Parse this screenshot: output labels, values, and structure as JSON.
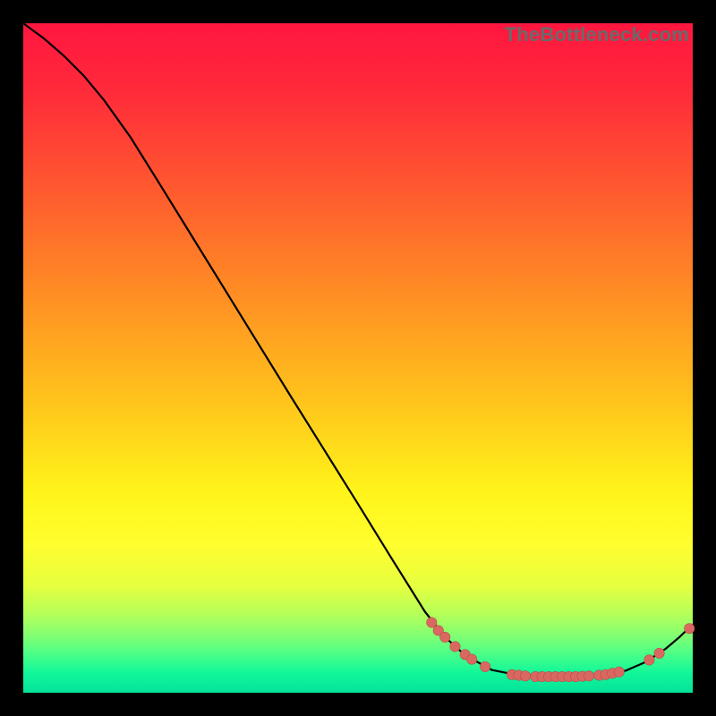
{
  "watermark": "TheBottleneck.com",
  "colors": {
    "background": "#000000",
    "curve_stroke": "#000000",
    "marker_fill": "#d96861",
    "marker_stroke": "#b84d48"
  },
  "chart_data": {
    "type": "line",
    "title": "",
    "xlabel": "",
    "ylabel": "",
    "xlim": [
      0,
      100
    ],
    "ylim": [
      0,
      100
    ],
    "curve": {
      "x": [
        0,
        3,
        6,
        9,
        12,
        16,
        20,
        25,
        30,
        35,
        40,
        45,
        50,
        55,
        60,
        63,
        66,
        70,
        74,
        78,
        82,
        86,
        90,
        93,
        96,
        98,
        100
      ],
      "y": [
        100,
        97.8,
        95.2,
        92.2,
        88.6,
        83.0,
        76.6,
        68.5,
        60.4,
        52.3,
        44.2,
        36.2,
        28.2,
        20.1,
        12.1,
        8.3,
        5.6,
        3.4,
        2.6,
        2.4,
        2.4,
        2.6,
        3.3,
        4.6,
        6.6,
        8.3,
        10.2
      ]
    },
    "markers": [
      {
        "x": 61.0,
        "y": 10.5
      },
      {
        "x": 62.0,
        "y": 9.3
      },
      {
        "x": 63.0,
        "y": 8.3
      },
      {
        "x": 64.5,
        "y": 6.9
      },
      {
        "x": 66.0,
        "y": 5.7
      },
      {
        "x": 67.0,
        "y": 5.0
      },
      {
        "x": 69.0,
        "y": 3.9
      },
      {
        "x": 73.0,
        "y": 2.7
      },
      {
        "x": 74.0,
        "y": 2.6
      },
      {
        "x": 75.0,
        "y": 2.5
      },
      {
        "x": 76.5,
        "y": 2.4
      },
      {
        "x": 77.5,
        "y": 2.4
      },
      {
        "x": 78.5,
        "y": 2.4
      },
      {
        "x": 79.5,
        "y": 2.4
      },
      {
        "x": 80.5,
        "y": 2.4
      },
      {
        "x": 81.5,
        "y": 2.4
      },
      {
        "x": 82.5,
        "y": 2.4
      },
      {
        "x": 83.5,
        "y": 2.45
      },
      {
        "x": 84.5,
        "y": 2.5
      },
      {
        "x": 86.0,
        "y": 2.6
      },
      {
        "x": 87.0,
        "y": 2.7
      },
      {
        "x": 88.0,
        "y": 2.9
      },
      {
        "x": 89.0,
        "y": 3.1
      },
      {
        "x": 93.5,
        "y": 4.9
      },
      {
        "x": 95.0,
        "y": 5.9
      },
      {
        "x": 99.5,
        "y": 9.6
      }
    ]
  }
}
